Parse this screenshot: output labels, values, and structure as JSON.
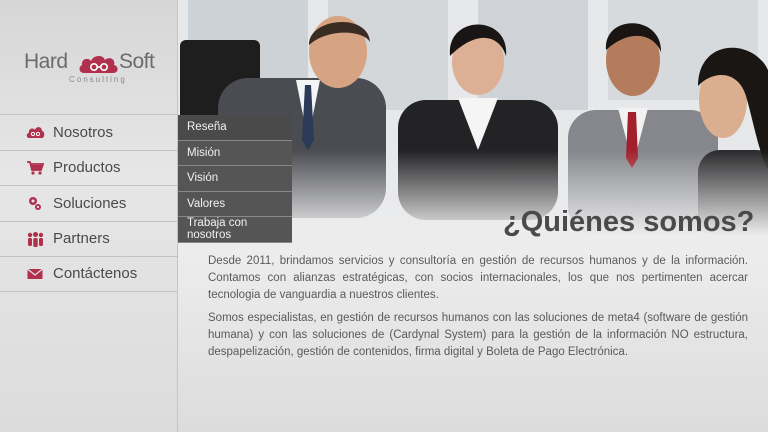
{
  "brand": {
    "name_part1": "Hard",
    "name_part2": "Soft",
    "tagline": "Consulting",
    "accent_color": "#b0304e"
  },
  "nav": {
    "items": [
      {
        "label": "Nosotros",
        "icon": "cloud-icon"
      },
      {
        "label": "Productos",
        "icon": "cart-icon"
      },
      {
        "label": "Soluciones",
        "icon": "gears-icon"
      },
      {
        "label": "Partners",
        "icon": "people-icon"
      },
      {
        "label": "Contáctenos",
        "icon": "envelope-icon"
      }
    ]
  },
  "submenu": {
    "items": [
      {
        "label": "Reseña"
      },
      {
        "label": "Misión"
      },
      {
        "label": "Visión"
      },
      {
        "label": "Valores"
      },
      {
        "label": "Trabaja con nosotros"
      }
    ]
  },
  "content": {
    "title": "¿Quiénes somos?",
    "paragraph1": "Desde 2011, brindamos servicios y consultoría en gestión de recursos humanos y de la información. Contamos con alianzas estratégicas, con socios internacionales, los que nos pertimenten acercar tecnologia de vanguardia a nuestros clientes.",
    "paragraph2": "Somos especialistas, en gestión de recursos humanos con   las soluciones de meta4 (software de gestión humana) y con las soluciones de (Cardynal System) para la gestión de la información NO estructura, despapelización, gestión de contenidos, firma digital y Boleta de Pago Electrónica."
  }
}
